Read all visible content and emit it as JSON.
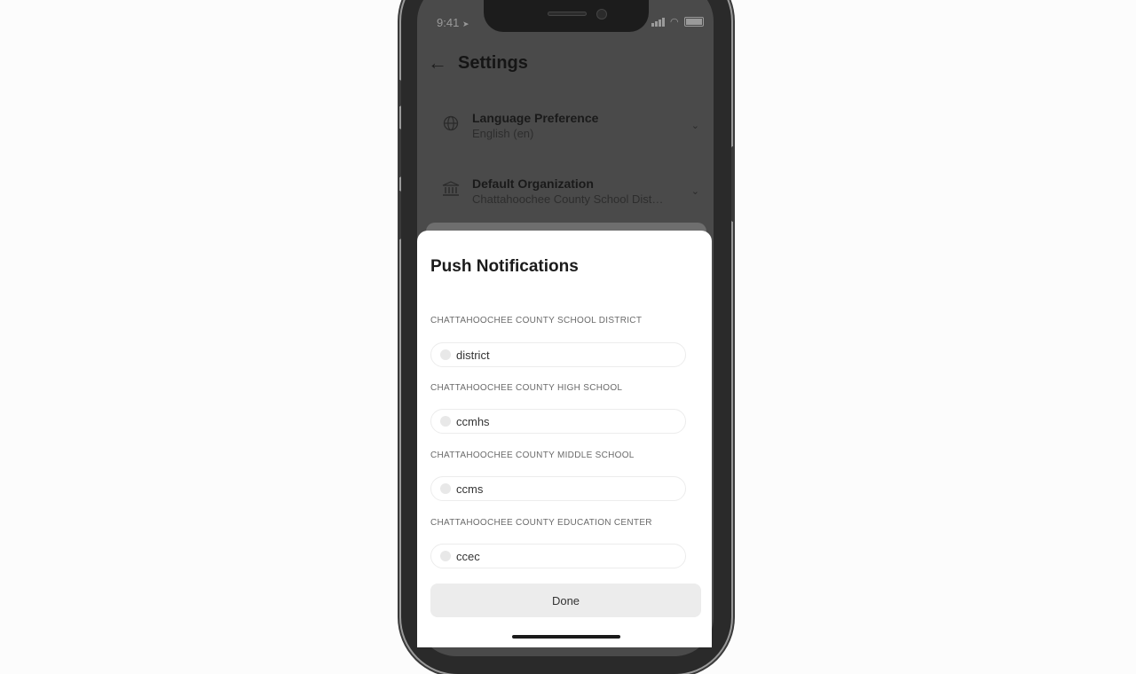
{
  "status_bar": {
    "time": "9:41"
  },
  "settings": {
    "title": "Settings",
    "items": [
      {
        "icon": "globe-icon",
        "title": "Language Preference",
        "subtitle": "English (en)"
      },
      {
        "icon": "building-icon",
        "title": "Default Organization",
        "subtitle": "Chattahoochee County School District"
      }
    ]
  },
  "sheet": {
    "title": "Push Notifications",
    "groups": [
      {
        "label": "CHATTAHOOCHEE COUNTY SCHOOL DISTRICT",
        "option": "district"
      },
      {
        "label": "CHATTAHOOCHEE COUNTY HIGH SCHOOL",
        "option": "ccmhs"
      },
      {
        "label": "CHATTAHOOCHEE COUNTY MIDDLE SCHOOL",
        "option": "ccms"
      },
      {
        "label": "CHATTAHOOCHEE COUNTY EDUCATION CENTER",
        "option": "ccec"
      }
    ],
    "done_label": "Done"
  }
}
